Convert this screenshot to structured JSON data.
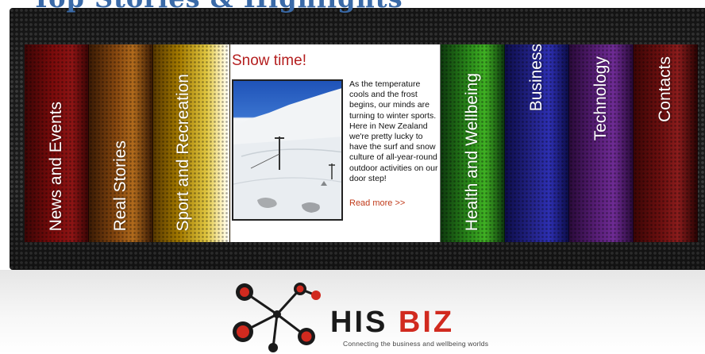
{
  "header": {
    "cut_title": "Top Stories & Highlights"
  },
  "nav": {
    "news": "News and Events",
    "real": "Real Stories",
    "sport": "Sport and Recreation",
    "health": "Health and Wellbeing",
    "business": "Business",
    "technology": "Technology",
    "contacts": "Contacts"
  },
  "feature": {
    "title": "Snow time!",
    "body": "As the temperature cools and the frost begins, our minds are turning to winter sports. Here in New Zealand we're pretty lucky to have the surf and snow culture of all-year-round outdoor activities on our door step!",
    "read_more": "Read more >>",
    "image_icon": "ski-field-photo"
  },
  "footer": {
    "logo_text": "HISBIZ",
    "tagline": "Connecting the business and wellbeing worlds"
  },
  "colors": {
    "accent_red": "#b41e1e",
    "title_blue": "#3a6aa8",
    "logo_red": "#d12a1f",
    "logo_black": "#1a1a1a"
  }
}
